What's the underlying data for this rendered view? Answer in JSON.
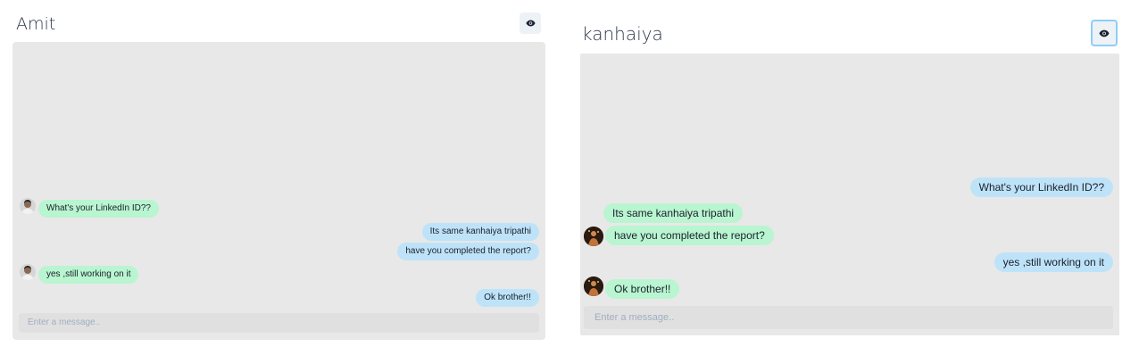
{
  "chats": [
    {
      "title": "Amit",
      "input_placeholder": "Enter a message..",
      "messages": [
        {
          "text": "What's your LinkedIn ID??",
          "from": "other"
        },
        {
          "text": "Its same kanhaiya tripathi",
          "from": "me"
        },
        {
          "text": "have you completed the report?",
          "from": "me"
        },
        {
          "text": "yes ,still working on it",
          "from": "other"
        },
        {
          "text": "Ok brother!!",
          "from": "me"
        }
      ]
    },
    {
      "title": "kanhaiya",
      "input_placeholder": "Enter a message..",
      "messages": [
        {
          "text": "What's your LinkedIn ID??",
          "from": "me"
        },
        {
          "text": "Its same kanhaiya tripathi",
          "from": "other"
        },
        {
          "text": "have you completed the report?",
          "from": "other"
        },
        {
          "text": "yes ,still working on it",
          "from": "me"
        },
        {
          "text": "Ok brother!!",
          "from": "other"
        }
      ]
    }
  ],
  "icons": {
    "view_profile": "eye-icon",
    "avatar": "avatar-image"
  },
  "colors": {
    "sent_bubble": "#bee3f8",
    "received_bubble": "#b9f5d0",
    "chat_background": "#e8e8e8"
  }
}
